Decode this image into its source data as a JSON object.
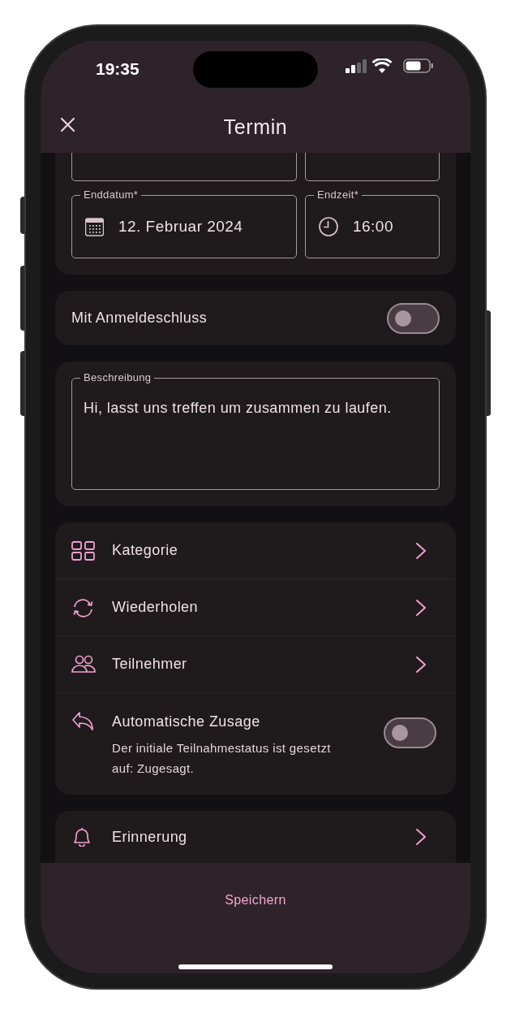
{
  "status_bar": {
    "time": "19:35"
  },
  "header": {
    "title": "Termin"
  },
  "date_rows": [
    {
      "fields": [
        {
          "kind": "date"
        },
        {
          "kind": "time"
        }
      ]
    },
    {
      "fields": [
        {
          "kind": "date",
          "label": "Enddatum*",
          "value": "12. Februar 2024"
        },
        {
          "kind": "time",
          "label": "Endzeit*",
          "value": "16:00"
        }
      ]
    }
  ],
  "registration_deadline": {
    "label": "Mit Anmeldeschluss",
    "on": false
  },
  "description": {
    "label": "Beschreibung",
    "value": "Hi, lasst uns treffen um zusammen zu laufen."
  },
  "option_groups": [
    {
      "items": [
        {
          "kind": "link",
          "label": "Kategorie"
        },
        {
          "kind": "link",
          "label": "Wiederholen"
        },
        {
          "kind": "link",
          "label": "Teilnehmer"
        },
        {
          "kind": "toggle",
          "label": "Automatische Zusage",
          "description": "Der initiale Teilnahmestatus ist gesetzt auf: Zugesagt.",
          "on": false
        }
      ]
    },
    {
      "items": [
        {
          "kind": "link",
          "label": "Erinnerung"
        }
      ]
    }
  ],
  "save_button": {
    "label": "Speichern"
  }
}
